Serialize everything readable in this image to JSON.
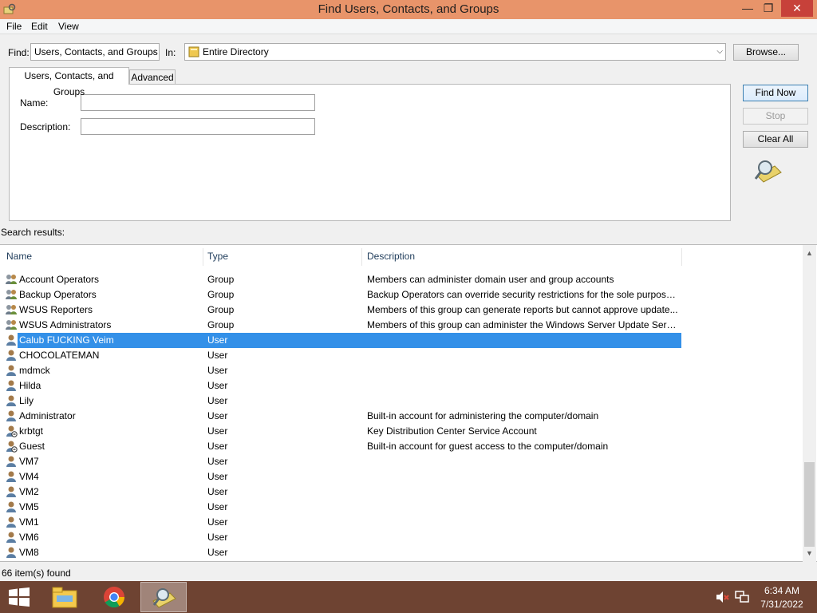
{
  "window": {
    "title": "Find Users, Contacts, and Groups"
  },
  "menu": [
    "File",
    "Edit",
    "View"
  ],
  "find": {
    "find_label": "Find:",
    "find_value": "Users, Contacts, and Groups",
    "in_label": "In:",
    "in_value": "Entire Directory",
    "browse_label": "Browse..."
  },
  "tabs": [
    "Users, Contacts, and Groups",
    "Advanced"
  ],
  "form": {
    "name_label": "Name:",
    "name_value": "",
    "description_label": "Description:",
    "description_value": ""
  },
  "actions": {
    "find_now": "Find Now",
    "stop": "Stop",
    "clear_all": "Clear All"
  },
  "results": {
    "label": "Search results:",
    "columns": [
      "Name",
      "Type",
      "Description"
    ],
    "rows": [
      {
        "name": "Account Operators",
        "type": "Group",
        "description": "Members can administer domain user and group accounts",
        "icon": "group-icon"
      },
      {
        "name": "Backup Operators",
        "type": "Group",
        "description": "Backup Operators can override security restrictions for the sole purpose ...",
        "icon": "group-icon"
      },
      {
        "name": "WSUS Reporters",
        "type": "Group",
        "description": "Members of this group can generate reports but cannot approve update...",
        "icon": "group-icon"
      },
      {
        "name": "WSUS Administrators",
        "type": "Group",
        "description": "Members of this group can administer the Windows Server Update Servi...",
        "icon": "group-icon"
      },
      {
        "name": "Calub FUCKING Veim",
        "type": "User",
        "description": "",
        "icon": "user-icon",
        "selected": true
      },
      {
        "name": "CHOCOLATEMAN",
        "type": "User",
        "description": "",
        "icon": "user-icon"
      },
      {
        "name": "mdmck",
        "type": "User",
        "description": "",
        "icon": "user-icon"
      },
      {
        "name": "Hilda",
        "type": "User",
        "description": "",
        "icon": "user-icon"
      },
      {
        "name": "Lily",
        "type": "User",
        "description": "",
        "icon": "user-icon"
      },
      {
        "name": "Administrator",
        "type": "User",
        "description": "Built-in account for administering the computer/domain",
        "icon": "user-icon"
      },
      {
        "name": "krbtgt",
        "type": "User",
        "description": "Key Distribution Center Service Account",
        "icon": "disabled-user-icon"
      },
      {
        "name": "Guest",
        "type": "User",
        "description": "Built-in account for guest access to the computer/domain",
        "icon": "disabled-user-icon"
      },
      {
        "name": "VM7",
        "type": "User",
        "description": "",
        "icon": "user-icon"
      },
      {
        "name": "VM4",
        "type": "User",
        "description": "",
        "icon": "user-icon"
      },
      {
        "name": "VM2",
        "type": "User",
        "description": "",
        "icon": "user-icon"
      },
      {
        "name": "VM5",
        "type": "User",
        "description": "",
        "icon": "user-icon"
      },
      {
        "name": "VM1",
        "type": "User",
        "description": "",
        "icon": "user-icon"
      },
      {
        "name": "VM6",
        "type": "User",
        "description": "",
        "icon": "user-icon"
      },
      {
        "name": "VM8",
        "type": "User",
        "description": "",
        "icon": "user-icon"
      }
    ]
  },
  "status": {
    "text": "66 item(s) found"
  },
  "taskbar": {
    "apps": [
      "start-icon",
      "file-explorer-icon",
      "chrome-icon",
      "find-users-icon"
    ],
    "time": "6:34 AM",
    "date": "7/31/2022"
  },
  "colors": {
    "titlebar": "#e8946a",
    "selection": "#3390e8",
    "taskbar": "#6e4332",
    "close": "#c7413a"
  }
}
